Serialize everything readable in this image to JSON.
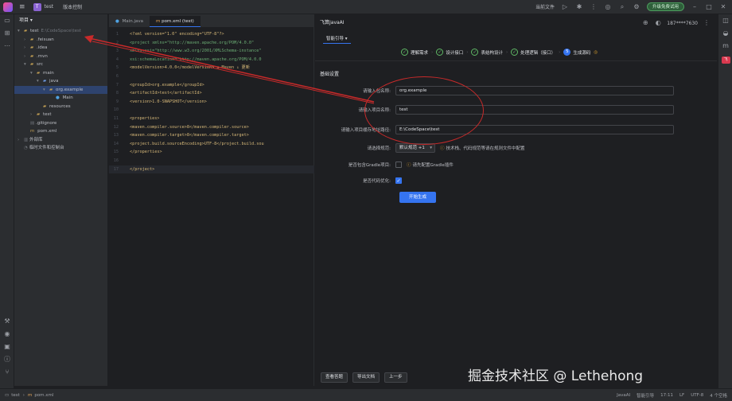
{
  "titlebar": {
    "project_badge": "T",
    "project_name": "test",
    "version_control": "版本控制",
    "current_file": "当前文件",
    "green_pill": "升级免费试用"
  },
  "project_panel": {
    "title": "项目",
    "tree": [
      {
        "indent": 0,
        "arrow": "▾",
        "icon": "folder",
        "label": "test",
        "extra": "E:\\CodeSpace\\test",
        "name": "tree-test"
      },
      {
        "indent": 1,
        "arrow": "›",
        "icon": "folder",
        "label": ".feisuan",
        "name": "tree-feisuan"
      },
      {
        "indent": 1,
        "arrow": "›",
        "icon": "folder",
        "label": ".idea",
        "name": "tree-idea"
      },
      {
        "indent": 1,
        "arrow": "›",
        "icon": "folder",
        "label": ".mvn",
        "name": "tree-mvn"
      },
      {
        "indent": 1,
        "arrow": "▾",
        "icon": "folder",
        "label": "src",
        "name": "tree-src"
      },
      {
        "indent": 2,
        "arrow": "▾",
        "icon": "folder",
        "label": "main",
        "name": "tree-main"
      },
      {
        "indent": 3,
        "arrow": "▾",
        "icon": "folder-blue",
        "label": "java",
        "name": "tree-java"
      },
      {
        "indent": 4,
        "arrow": "▾",
        "icon": "folder",
        "label": "org.example",
        "name": "tree-org-example",
        "selected": true
      },
      {
        "indent": 5,
        "arrow": "",
        "icon": "class",
        "label": "Main",
        "name": "tree-main-class"
      },
      {
        "indent": 3,
        "arrow": "",
        "icon": "folder",
        "label": "resources",
        "name": "tree-resources"
      },
      {
        "indent": 2,
        "arrow": "›",
        "icon": "folder",
        "label": "test",
        "name": "tree-test-dir"
      },
      {
        "indent": 1,
        "arrow": "",
        "icon": "file",
        "label": ".gitignore",
        "name": "tree-gitignore"
      },
      {
        "indent": 1,
        "arrow": "",
        "icon": "maven",
        "label": "pom.xml",
        "name": "tree-pom"
      },
      {
        "indent": 0,
        "arrow": "›",
        "icon": "lib",
        "label": "外部库",
        "name": "tree-external-libs"
      },
      {
        "indent": 0,
        "arrow": "",
        "icon": "scratch",
        "label": "临时文件和控制台",
        "name": "tree-scratches"
      }
    ]
  },
  "editor": {
    "tabs": [
      {
        "label": "Main.java",
        "active": false,
        "icon": "c"
      },
      {
        "label": "pom.xml (test)",
        "active": true,
        "icon": "m"
      }
    ],
    "lines": [
      {
        "n": "1",
        "text": "<?xml version=\"1.0\" encoding=\"UTF-8\"?>"
      },
      {
        "n": "2",
        "text": "<project xmlns=\"http://maven.apache.org/POM/4.0.0\""
      },
      {
        "n": "3",
        "text": "         xmlns:xsi=\"http://www.w3.org/2001/XMLSchema-instance\""
      },
      {
        "n": "4",
        "text": "         xsi:schemaLocation=\"http://maven.apache.org/POM/4.0.0"
      },
      {
        "n": "5",
        "text": "    <modelVersion>4.0.0</modelVersion>  ⇅ Maven ↓ 更新"
      },
      {
        "n": "6",
        "text": ""
      },
      {
        "n": "7",
        "text": "    <groupId>org.example</groupId>"
      },
      {
        "n": "8",
        "text": "    <artifactId>test</artifactId>"
      },
      {
        "n": "9",
        "text": "    <version>1.0-SNAPSHOT</version>"
      },
      {
        "n": "10",
        "text": ""
      },
      {
        "n": "11",
        "text": "    <properties>"
      },
      {
        "n": "12",
        "text": "        <maven.compiler.source>8</maven.compiler.source>"
      },
      {
        "n": "13",
        "text": "        <maven.compiler.target>8</maven.compiler.target>"
      },
      {
        "n": "14",
        "text": "        <project.build.sourceEncoding>UTF-8</project.build.sou"
      },
      {
        "n": "15",
        "text": "    </properties>"
      },
      {
        "n": "16",
        "text": ""
      },
      {
        "n": "17",
        "text": "</project>"
      }
    ]
  },
  "main": {
    "header": "飞算JavaAI",
    "tab": "智能引导",
    "user": "187****7630",
    "steps": [
      {
        "label": "理解需求",
        "done": true
      },
      {
        "label": "设计接口",
        "done": true
      },
      {
        "label": "表结构设计",
        "done": true
      },
      {
        "label": "处理逻辑（接口）",
        "done": true
      },
      {
        "label": "生成源码",
        "done": false,
        "num": "5"
      }
    ],
    "section_title": "基础设置",
    "fields": {
      "package_label": "请输入包名称:",
      "package_value": "org.example",
      "project_name_label": "请输入项目名称:",
      "project_name_value": "test",
      "path_label": "请输入项目缓存地址路径:",
      "path_value": "E:\\CodeSpace\\test",
      "spec_label": "请选择规范:",
      "spec_value": "默认规范 +1",
      "spec_hint": "技术栈、代码规范等请在规则文件中配置",
      "gradle_label": "是否包含Gradle项目:",
      "gradle_hint": "请先配置Gradle插件",
      "optimize_label": "是否代码优化:"
    },
    "generate_button": "开始生成",
    "bottom_buttons": [
      "查看答题",
      "导出文档",
      "上一步"
    ]
  },
  "status": {
    "breadcrumb_project": "test",
    "breadcrumb_file": "pom.xml",
    "right": [
      "JavaAI",
      "智能引导",
      "17:11",
      "LF",
      "UTF-8",
      "4 个空格"
    ]
  },
  "watermark": "掘金技术社区 @ Lethehong"
}
